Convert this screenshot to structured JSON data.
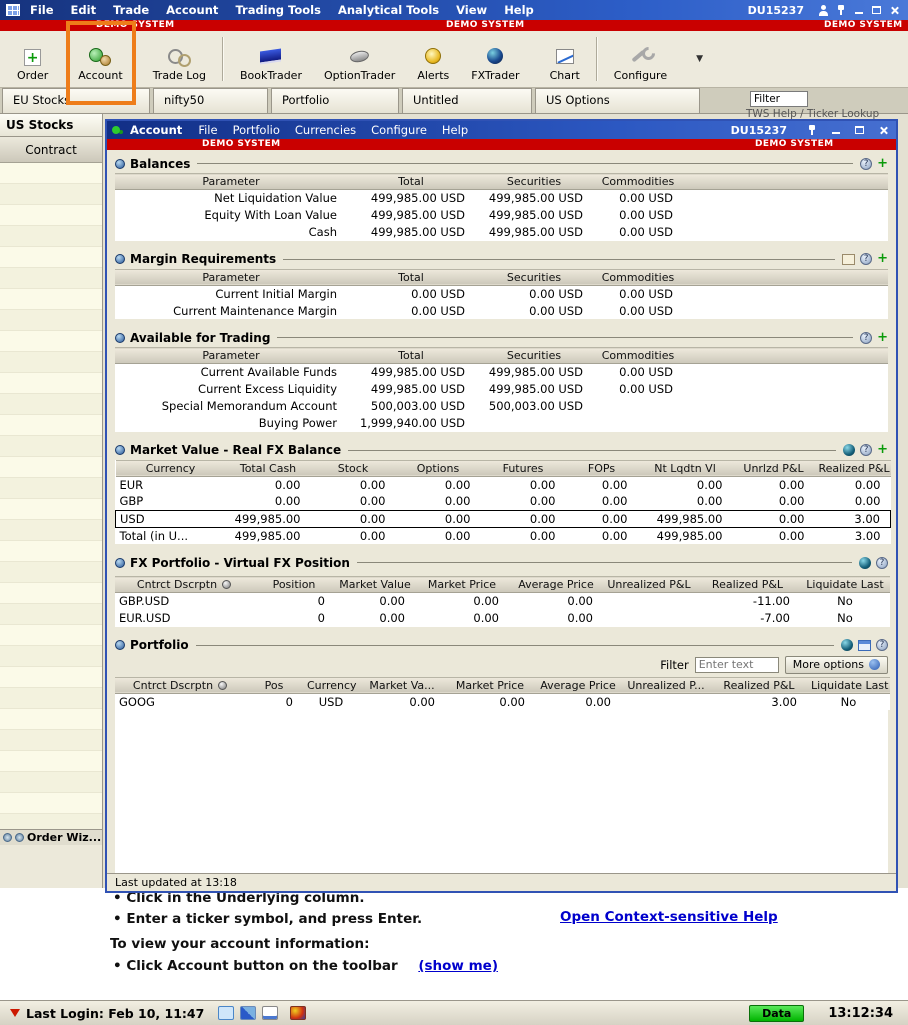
{
  "chrome": {
    "title_demo": "DEMO SYSTEM",
    "account_id": "DU15237",
    "menus": [
      "File",
      "Edit",
      "Trade",
      "Account",
      "Trading Tools",
      "Analytical Tools",
      "View",
      "Help"
    ]
  },
  "toolbar": {
    "buttons": [
      {
        "label": "Order"
      },
      {
        "label": "Account"
      },
      {
        "label": "Trade Log"
      },
      {
        "label": "BookTrader"
      },
      {
        "label": "OptionTrader"
      },
      {
        "label": "Alerts"
      },
      {
        "label": "FXTrader"
      },
      {
        "label": "Chart"
      },
      {
        "label": "Configure"
      }
    ]
  },
  "tabs": {
    "items": [
      "EU Stocks",
      "nifty50",
      "Portfolio",
      "Untitled",
      "US Options"
    ],
    "filter_value": "Filter",
    "peek_text": "TWS Help / Ticker Lookup"
  },
  "left_panel": {
    "tab_label": "US Stocks",
    "column_header": "Contract",
    "order_wizard_label": "Order Wiz..."
  },
  "account_window": {
    "title": "Account",
    "menus": [
      "File",
      "Portfolio",
      "Currencies",
      "Configure",
      "Help"
    ],
    "account_id": "DU15237",
    "demo_banner": "DEMO SYSTEM",
    "status": "Last updated at 13:18",
    "balances": {
      "title": "Balances",
      "headers": [
        "Parameter",
        "Total",
        "Securities",
        "Commodities"
      ],
      "rows": [
        [
          "Net Liquidation Value",
          "499,985.00 USD",
          "499,985.00 USD",
          "0.00 USD"
        ],
        [
          "Equity With Loan Value",
          "499,985.00 USD",
          "499,985.00 USD",
          "0.00 USD"
        ],
        [
          "Cash",
          "499,985.00 USD",
          "499,985.00 USD",
          "0.00 USD"
        ]
      ]
    },
    "margin": {
      "title": "Margin Requirements",
      "headers": [
        "Parameter",
        "Total",
        "Securities",
        "Commodities"
      ],
      "rows": [
        [
          "Current Initial Margin",
          "0.00 USD",
          "0.00 USD",
          "0.00 USD"
        ],
        [
          "Current Maintenance Margin",
          "0.00 USD",
          "0.00 USD",
          "0.00 USD"
        ]
      ]
    },
    "available": {
      "title": "Available for Trading",
      "headers": [
        "Parameter",
        "Total",
        "Securities",
        "Commodities"
      ],
      "rows": [
        [
          "Current Available Funds",
          "499,985.00 USD",
          "499,985.00 USD",
          "0.00 USD"
        ],
        [
          "Current Excess Liquidity",
          "499,985.00 USD",
          "499,985.00 USD",
          "0.00 USD"
        ],
        [
          "Special Memorandum Account",
          "500,003.00 USD",
          "500,003.00 USD",
          ""
        ],
        [
          "Buying Power",
          "1,999,940.00 USD",
          "",
          ""
        ]
      ]
    },
    "market_value": {
      "title": "Market Value - Real FX Balance",
      "headers": [
        "Currency",
        "Total Cash",
        "Stock",
        "Options",
        "Futures",
        "FOPs",
        "Nt Lqdtn Vl",
        "Unrlzd P&L",
        "Realized P&L"
      ],
      "rows": [
        [
          "EUR",
          "0.00",
          "0.00",
          "0.00",
          "0.00",
          "0.00",
          "0.00",
          "0.00",
          "0.00"
        ],
        [
          "GBP",
          "0.00",
          "0.00",
          "0.00",
          "0.00",
          "0.00",
          "0.00",
          "0.00",
          "0.00"
        ],
        [
          "USD",
          "499,985.00",
          "0.00",
          "0.00",
          "0.00",
          "0.00",
          "499,985.00",
          "0.00",
          "3.00"
        ],
        [
          "Total (in U...",
          "499,985.00",
          "0.00",
          "0.00",
          "0.00",
          "0.00",
          "499,985.00",
          "0.00",
          "3.00"
        ]
      ]
    },
    "fx_portfolio": {
      "title": "FX Portfolio - Virtual FX Position",
      "headers": [
        "Cntrct Dscrptn",
        "Position",
        "Market Value",
        "Market Price",
        "Average Price",
        "Unrealized P&L",
        "Realized P&L",
        "Liquidate Last"
      ],
      "rows": [
        [
          "GBP.USD",
          "0",
          "0.00",
          "0.00",
          "0.00",
          "",
          "-11.00",
          "No"
        ],
        [
          "EUR.USD",
          "0",
          "0.00",
          "0.00",
          "0.00",
          "",
          "-7.00",
          "No"
        ]
      ]
    },
    "portfolio": {
      "title": "Portfolio",
      "filter_label": "Filter",
      "filter_placeholder": "Enter text",
      "more_options_label": "More options",
      "headers": [
        "Cntrct Dscrptn",
        "Pos",
        "Currency",
        "Market Va...",
        "Market Price",
        "Average Price",
        "Unrealized P...",
        "Realized P&L",
        "Liquidate Last"
      ],
      "rows": [
        [
          "GOOG",
          "0",
          "USD",
          "0.00",
          "0.00",
          "0.00",
          "",
          "3.00",
          "No"
        ]
      ]
    }
  },
  "help_panel": {
    "bullet_1": "Click in the Underlying column.",
    "bullet_2": "Enter a ticker symbol, and press Enter.",
    "context_help_link": "Open Context-sensitive Help",
    "heading": "To view your account information:",
    "bullet_3": "Click Account button on the toolbar",
    "show_me_link": "(show me)"
  },
  "status_bar": {
    "last_login": "Last Login: Feb 10, 11:47",
    "data_badge": "Data",
    "clock": "13:12:34"
  }
}
